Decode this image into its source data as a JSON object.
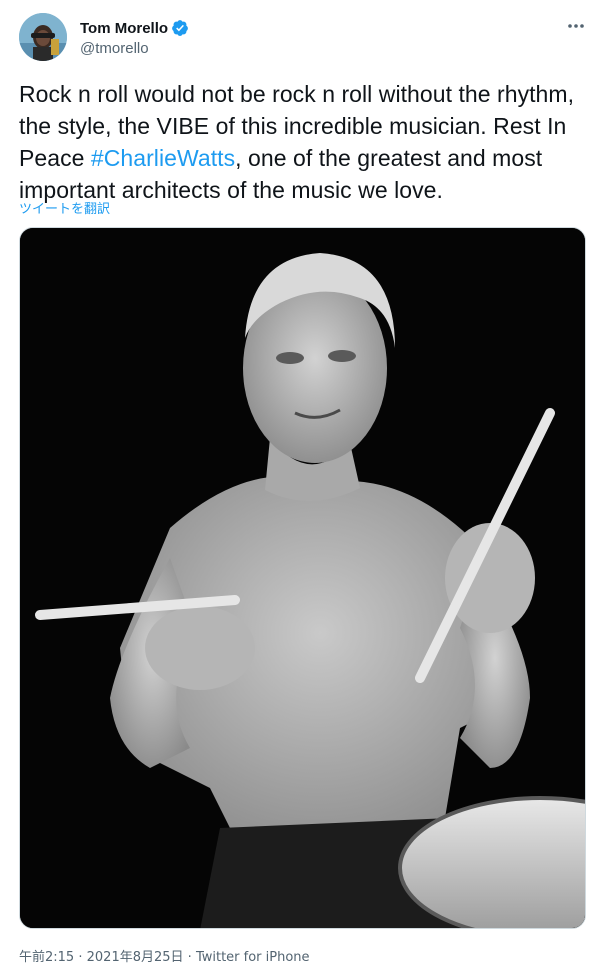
{
  "author": {
    "display_name": "Tom Morello",
    "handle": "@tmorello",
    "verified": true,
    "verified_color": "#1d9bf0"
  },
  "tweet": {
    "text_before": "Rock n roll would not be rock n roll without the rhythm, the style, the VIBE of this incredible musician. Rest In Peace ",
    "hashtag": "#CharlieWatts",
    "text_after": ", one of the greatest and most important architects of the music we love.",
    "translate_label": "ツイートを翻訳",
    "link_color": "#1d9bf0"
  },
  "media": {
    "icon": "photo"
  },
  "meta": {
    "time": "午前2:15",
    "separator": "·",
    "date": "2021年8月25日",
    "source": "Twitter for iPhone"
  },
  "icons": {
    "more": "more-horizontal-icon",
    "verified": "verified-badge-icon"
  }
}
